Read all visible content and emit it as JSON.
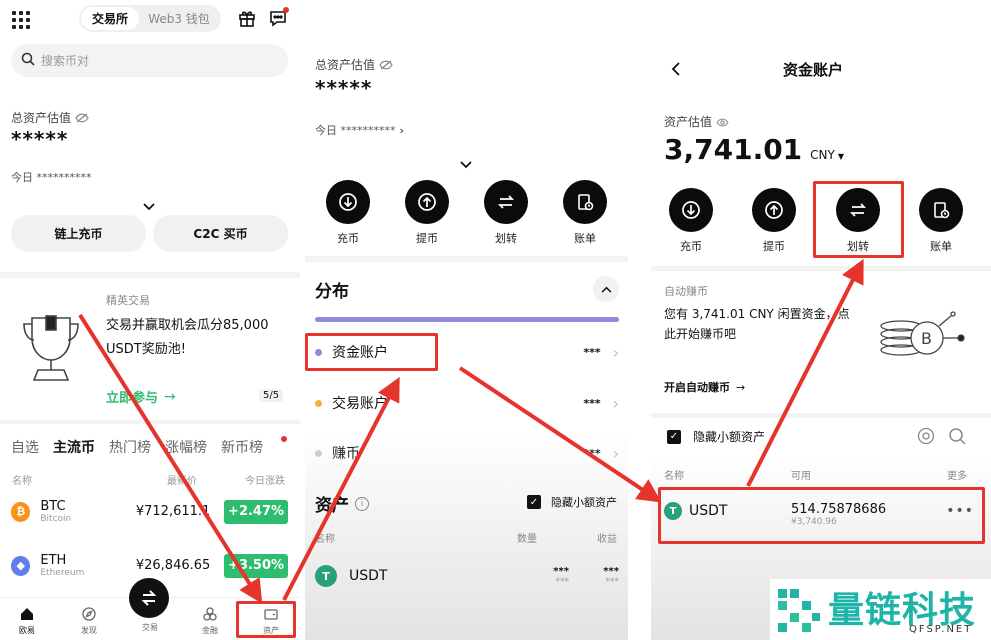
{
  "p1": {
    "exchange_tab": "交易所",
    "web3_tab": "Web3 钱包",
    "search_placeholder": "搜索币对",
    "total_label": "总资产估值",
    "total_value": "*****",
    "today_label": "今日 **********",
    "btn_onchain": "链上充币",
    "btn_c2c": "C2C 买币",
    "promo_kicker": "精英交易",
    "promo_text_1": "交易并赢取机会瓜分85,000",
    "promo_text_2": "USDT奖励池!",
    "promo_cta": "立即参与",
    "promo_pager": "5/5",
    "tabs": [
      "自选",
      "主流币",
      "热门榜",
      "涨幅榜",
      "新币榜"
    ],
    "col_name": "名称",
    "col_price": "最新价",
    "col_change": "今日涨跌",
    "coins": [
      {
        "symbol": "BTC",
        "name": "Bitcoin",
        "price": "¥712,611.1",
        "change": "+2.47%"
      },
      {
        "symbol": "ETH",
        "name": "Ethereum",
        "price": "¥26,846.65",
        "change": "+3.50%"
      }
    ],
    "nav": [
      "欧易",
      "发现",
      "交易",
      "金融",
      "资产"
    ]
  },
  "p2": {
    "total_label": "总资产估值",
    "total_value": "*****",
    "today_label": "今日 **********",
    "actions": [
      "充币",
      "提币",
      "划转",
      "账单"
    ],
    "dist_title": "分布",
    "accounts": [
      {
        "label": "资金账户",
        "value": "***"
      },
      {
        "label": "交易账户",
        "value": "***"
      },
      {
        "label": "赚币",
        "value": "***"
      }
    ],
    "assets_title": "资产",
    "hide_small": "隐藏小额资产",
    "col_name": "名称",
    "col_qty": "数量",
    "col_gain": "收益",
    "asset_symbol": "USDT",
    "asset_qty": "***",
    "asset_qty_sub": "***",
    "asset_gain": "***",
    "asset_gain_sub": "***"
  },
  "p3": {
    "title": "资金账户",
    "est_label": "资产估值",
    "est_value": "3,741.01",
    "currency": "CNY",
    "actions": [
      "充币",
      "提币",
      "划转",
      "账单"
    ],
    "auto_title": "自动赚币",
    "auto_text_1": "您有 3,741.01 CNY 闲置资金，点",
    "auto_text_2": "此开始赚币吧",
    "auto_cta": "开启自动赚币",
    "hide_small": "隐藏小额资产",
    "col_name": "名称",
    "col_avail": "可用",
    "col_more": "更多",
    "asset_symbol": "USDT",
    "asset_value": "514.75878686",
    "asset_cny": "¥3,740.96"
  },
  "watermark": {
    "text": "量链科技",
    "sub": "QFSP.NET"
  },
  "colors": {
    "accent_red": "#e4342c",
    "up_green": "#2ebd6e",
    "btc_orange": "#f7931a",
    "eth_blue": "#627eea",
    "usdt_teal": "#26a17b",
    "promo_green": "#2ebd6e"
  }
}
